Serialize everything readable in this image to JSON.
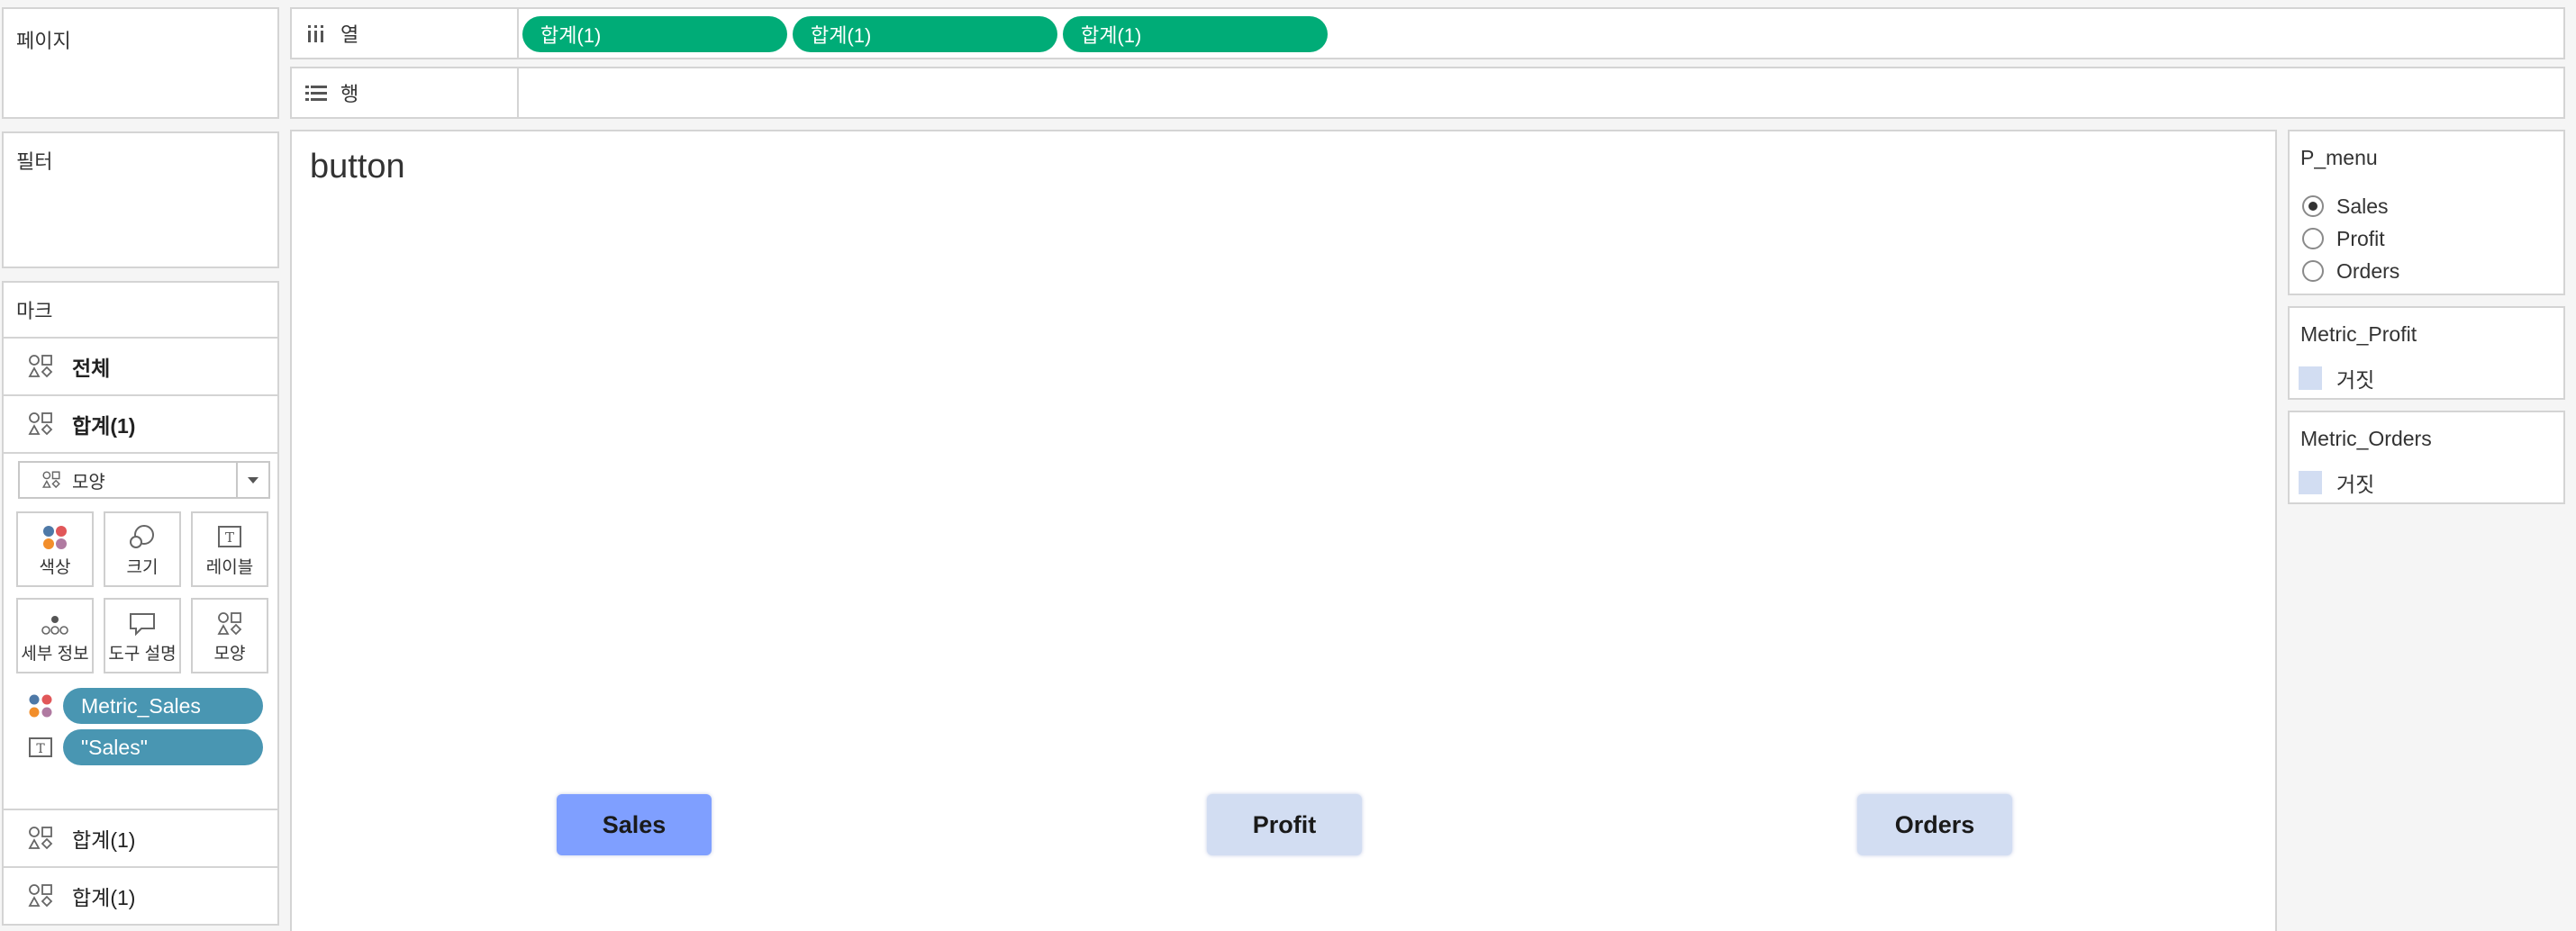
{
  "pages_panel": {
    "title": "페이지"
  },
  "filters_panel": {
    "title": "필터"
  },
  "columns_shelf": {
    "label": "열",
    "pills": [
      "합계(1)",
      "합계(1)",
      "합계(1)"
    ]
  },
  "rows_shelf": {
    "label": "행"
  },
  "marks_card": {
    "title": "마크",
    "rows": [
      {
        "label": "전체"
      },
      {
        "label": "합계(1)"
      }
    ],
    "mark_type": "모양",
    "encodings": [
      "색상",
      "크기",
      "레이블",
      "세부 정보",
      "도구 설명",
      "모양"
    ],
    "fields": [
      {
        "icon": "color-dots-icon",
        "label": "Metric_Sales"
      },
      {
        "icon": "text-label-icon",
        "label": "\"Sales\""
      }
    ],
    "bottom_rows": [
      {
        "label": "합계(1)"
      },
      {
        "label": "합계(1)"
      }
    ]
  },
  "canvas": {
    "title": "button",
    "buttons": [
      {
        "label": "Sales",
        "color": "#7f9fff"
      },
      {
        "label": "Profit",
        "color": "#d2ddf2"
      },
      {
        "label": "Orders",
        "color": "#d2ddf2"
      }
    ]
  },
  "p_menu": {
    "title": "P_menu",
    "options": [
      "Sales",
      "Profit",
      "Orders"
    ],
    "selected": "Sales"
  },
  "legend_profit": {
    "title": "Metric_Profit",
    "item": "거짓",
    "color": "#d2ddf2"
  },
  "legend_orders": {
    "title": "Metric_Orders",
    "item": "거짓",
    "color": "#d2ddf2"
  },
  "colors": {
    "green_pill": "#00ac77",
    "blue_pill": "#4996b2"
  }
}
